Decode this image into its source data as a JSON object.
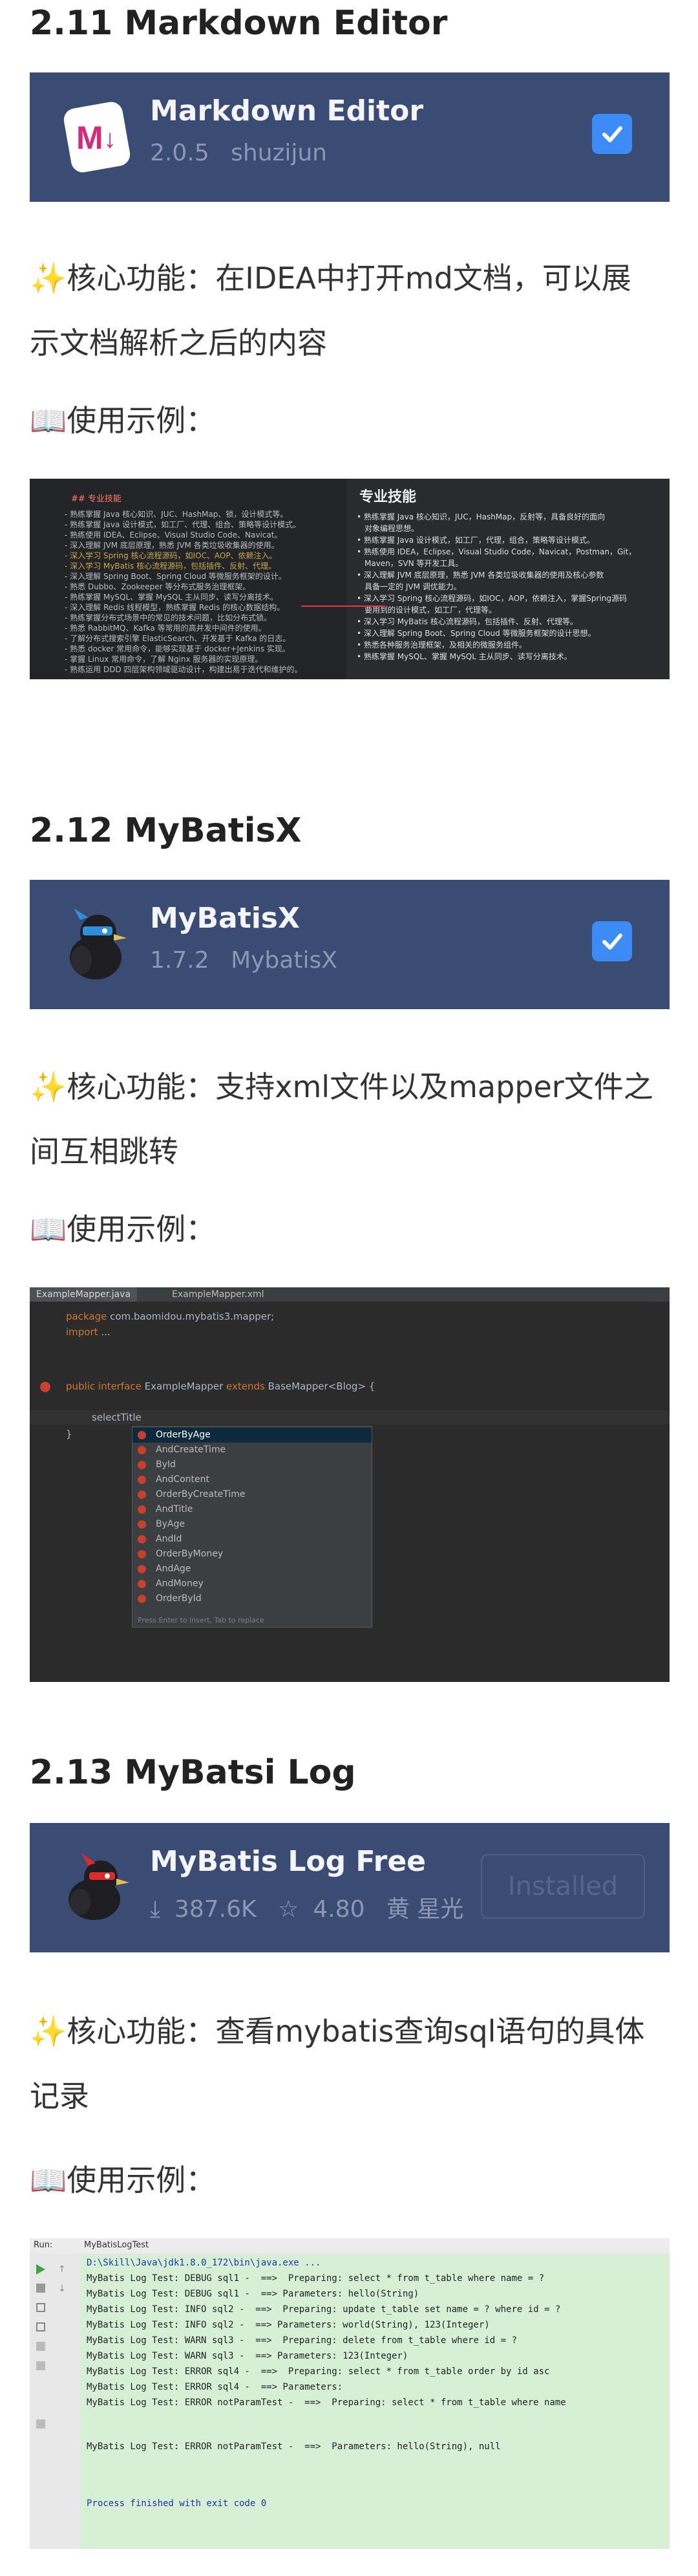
{
  "sections": [
    {
      "title": "2.11 Markdown Editor",
      "plugin": {
        "name": "Markdown Editor",
        "version": "2.0.5",
        "author": "shuzijun",
        "installed_checkbox": true
      },
      "feature_line1": "✨核心功能：在IDEA中打开md文档，可以展",
      "feature_line2": "示文档解析之后的内容",
      "example_label": "📖使用示例：",
      "screenshot": {
        "left_heading": "## 专业技能",
        "right_heading": "专业技能",
        "left_lines": [
          "- 熟练掌握 Java 核心知识、JUC、HashMap、锁，设计模式等。",
          "- 熟练掌握 Java 设计模式，如工厂、代理、组合、策略等设计模式。",
          "- 熟练使用 IDEA、Eclipse、Visual Studio Code、Navicat。",
          "- 深入理解 JVM 底层原理，熟悉 JVM 各类垃圾收集器的使用。",
          "- 深入学习 Spring 核心流程源码，如IOC、AOP、依赖注入。",
          "- 深入学习 MyBatis 核心流程源码，包括插件、反射、代理。",
          "- 深入理解 Spring Boot、Spring Cloud 等微服务框架的设计。",
          "- 熟悉 Dubbo、Zookeeper 等分布式服务治理框架。",
          "- 熟练掌握 MySQL、掌握 MySQL 主从同步、读写分离技术。",
          "- 深入理解 Redis 线程模型，熟练掌握 Redis 的核心数据结构。",
          "- 熟练掌握分布式场景中的常见的技术问题，比如分布式锁。",
          "- 熟悉 RabbitMQ、Kafka 等常用的高并发中间件的使用。",
          "- 了解分布式搜索引擎 ElasticSearch、开发基于 Kafka 的日志。",
          "- 熟悉 docker 常用命令，能够实现基于 docker+Jenkins 实现。",
          "- 掌握 Linux 常用命令，了解 Nginx 服务器的实现原理。",
          "- 熟练运用 DDD 四层架构领域驱动设计，构建出易于迭代和维护的。"
        ],
        "right_lines": [
          "• 熟练掌握 Java 核心知识，JUC，HashMap，反射等，具备良好的面向",
          "对象编程思想。",
          "• 熟练掌握 Java 设计模式，如工厂，代理，组合，策略等设计模式。",
          "• 熟练使用 IDEA，Eclipse，Visual Studio Code，Navicat，Postman，Git，",
          "Maven，SVN 等开发工具。",
          "• 深入理解 JVM 底层原理，熟悉 JVM 各类垃圾收集器的使用及核心参数",
          "具备一定的 JVM 调优能力。",
          "• 深入学习 Spring 核心流程源码，如IOC，AOP，依赖注入，掌握Spring源码",
          "要用到的设计模式，如工厂，代理等。",
          "• 深入学习 MyBatis 核心流程源码，包括插件、反射、代理等。",
          "• 深入理解 Spring Boot、Spring Cloud 等微服务框架的设计思想。",
          "• 熟悉各种服务治理框架，及相关的微服务组件。",
          "• 熟练掌握 MySQL、掌握 MySQL 主从同步、读写分离技术。"
        ]
      }
    },
    {
      "title": "2.12 MyBatisX",
      "plugin": {
        "name": "MyBatisX",
        "version": "1.7.2",
        "author": "MybatisX",
        "installed_checkbox": true
      },
      "feature_line1": "✨核心功能：支持xml文件以及mapper文件之",
      "feature_line2": "间互相跳转",
      "example_label": "📖使用示例：",
      "screenshot": {
        "tabs": [
          "ExampleMapper.java",
          "ExampleMapper.xml"
        ],
        "code": {
          "package_kw": "package",
          "package_name": "com.baomidou.mybatis3.mapper;",
          "import_kw": "import",
          "import_rest": "...",
          "public_kw": "public interface",
          "decl": "ExampleMapper",
          "extends_kw": "extends",
          "base": "BaseMapper<Blog> {",
          "typed": "selectTitle",
          "close": "}"
        },
        "completions": [
          "OrderByAge",
          "AndCreateTime",
          "ById",
          "AndContent",
          "OrderByCreateTime",
          "AndTitle",
          "ByAge",
          "AndId",
          "OrderByMoney",
          "AndAge",
          "AndMoney",
          "OrderById"
        ],
        "hint": "Press Enter to insert, Tab to replace"
      }
    },
    {
      "title": "2.13 MyBatsi Log",
      "plugin": {
        "name": "MyBatis Log Free",
        "downloads": "387.6K",
        "rating": "4.80",
        "author": "黄 星光",
        "installed_label": "Installed"
      },
      "feature_line1": "✨核心功能：查看mybatis查询sql语句的具体",
      "feature_line2": "记录",
      "example_label": "📖使用示例：",
      "screenshot": {
        "run_label": "Run:",
        "tab": "MyBatisLogTest",
        "path": "D:\\Skill\\Java\\jdk1.8.0_172\\bin\\java.exe ...",
        "lines": [
          "MyBatis Log Test: DEBUG sql1 -  ==>  Preparing: select * from t_table where name = ?",
          "MyBatis Log Test: DEBUG sql1 -  ==> Parameters: hello(String)",
          "MyBatis Log Test: INFO sql2 -  ==>  Preparing: update t_table set name = ? where id = ?",
          "MyBatis Log Test: INFO sql2 -  ==> Parameters: world(String), 123(Integer)",
          "MyBatis Log Test: WARN sql3 -  ==>  Preparing: delete from t_table where id = ?",
          "MyBatis Log Test: WARN sql3 -  ==> Parameters: 123(Integer)",
          "MyBatis Log Test: ERROR sql4 -  ==>  Preparing: select * from t_table order by id asc",
          "MyBatis Log Test: ERROR sql4 -  ==> Parameters:",
          "MyBatis Log Test: ERROR notParamTest -  ==>  Preparing: select * from t_table where name"
        ],
        "last_line": "MyBatis Log Test: ERROR notParamTest -  ==>  Parameters: hello(String), null",
        "exit": "Process finished with exit code 0"
      }
    }
  ],
  "colors": {
    "card_bg": "#3a4b74",
    "checkbox": "#3c8bf6",
    "console_bg": "#d7efd4"
  },
  "icons": [
    "markdown-logo-icon",
    "mybatisx-bird-icon",
    "mybatis-log-bird-icon",
    "check-icon",
    "download-icon",
    "star-icon"
  ]
}
